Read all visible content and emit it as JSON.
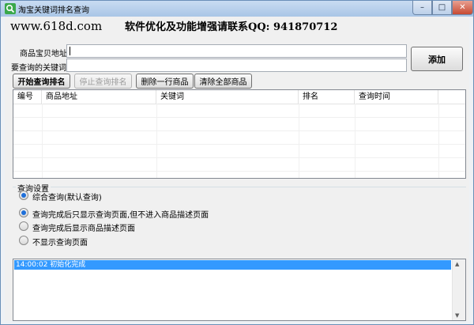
{
  "window": {
    "title": "淘宝关键词排名查询"
  },
  "header": {
    "site": "www.618d.com",
    "promo": "软件优化及功能增强请联系QQ: 941870712"
  },
  "form": {
    "url_label": "商品宝贝地址:",
    "url_value": "",
    "keyword_label": "要查询的关键词:",
    "keyword_value": "",
    "add_button": "添加"
  },
  "toolbar": {
    "start": "开始查询排名",
    "stop": "停止查询排名",
    "delete_row": "删除一行商品",
    "clear_all": "清除全部商品"
  },
  "table": {
    "columns": [
      "编号",
      "商品地址",
      "关键词",
      "排名",
      "查询时间"
    ],
    "rows": []
  },
  "settings": {
    "title": "查询设置",
    "options": [
      {
        "label": "综合查询(默认查询)",
        "checked": true
      },
      {
        "label": "查询完成后只显示查询页面,但不进入商品描述页面",
        "checked": true
      },
      {
        "label": "查询完成后显示商品描述页面",
        "checked": false
      },
      {
        "label": "不显示查询页面",
        "checked": false
      }
    ]
  },
  "log": {
    "lines": [
      "14:00:02 初始化完成"
    ]
  },
  "colors": {
    "selection": "#3399ff",
    "radio_dot": "#1e6fd9"
  }
}
